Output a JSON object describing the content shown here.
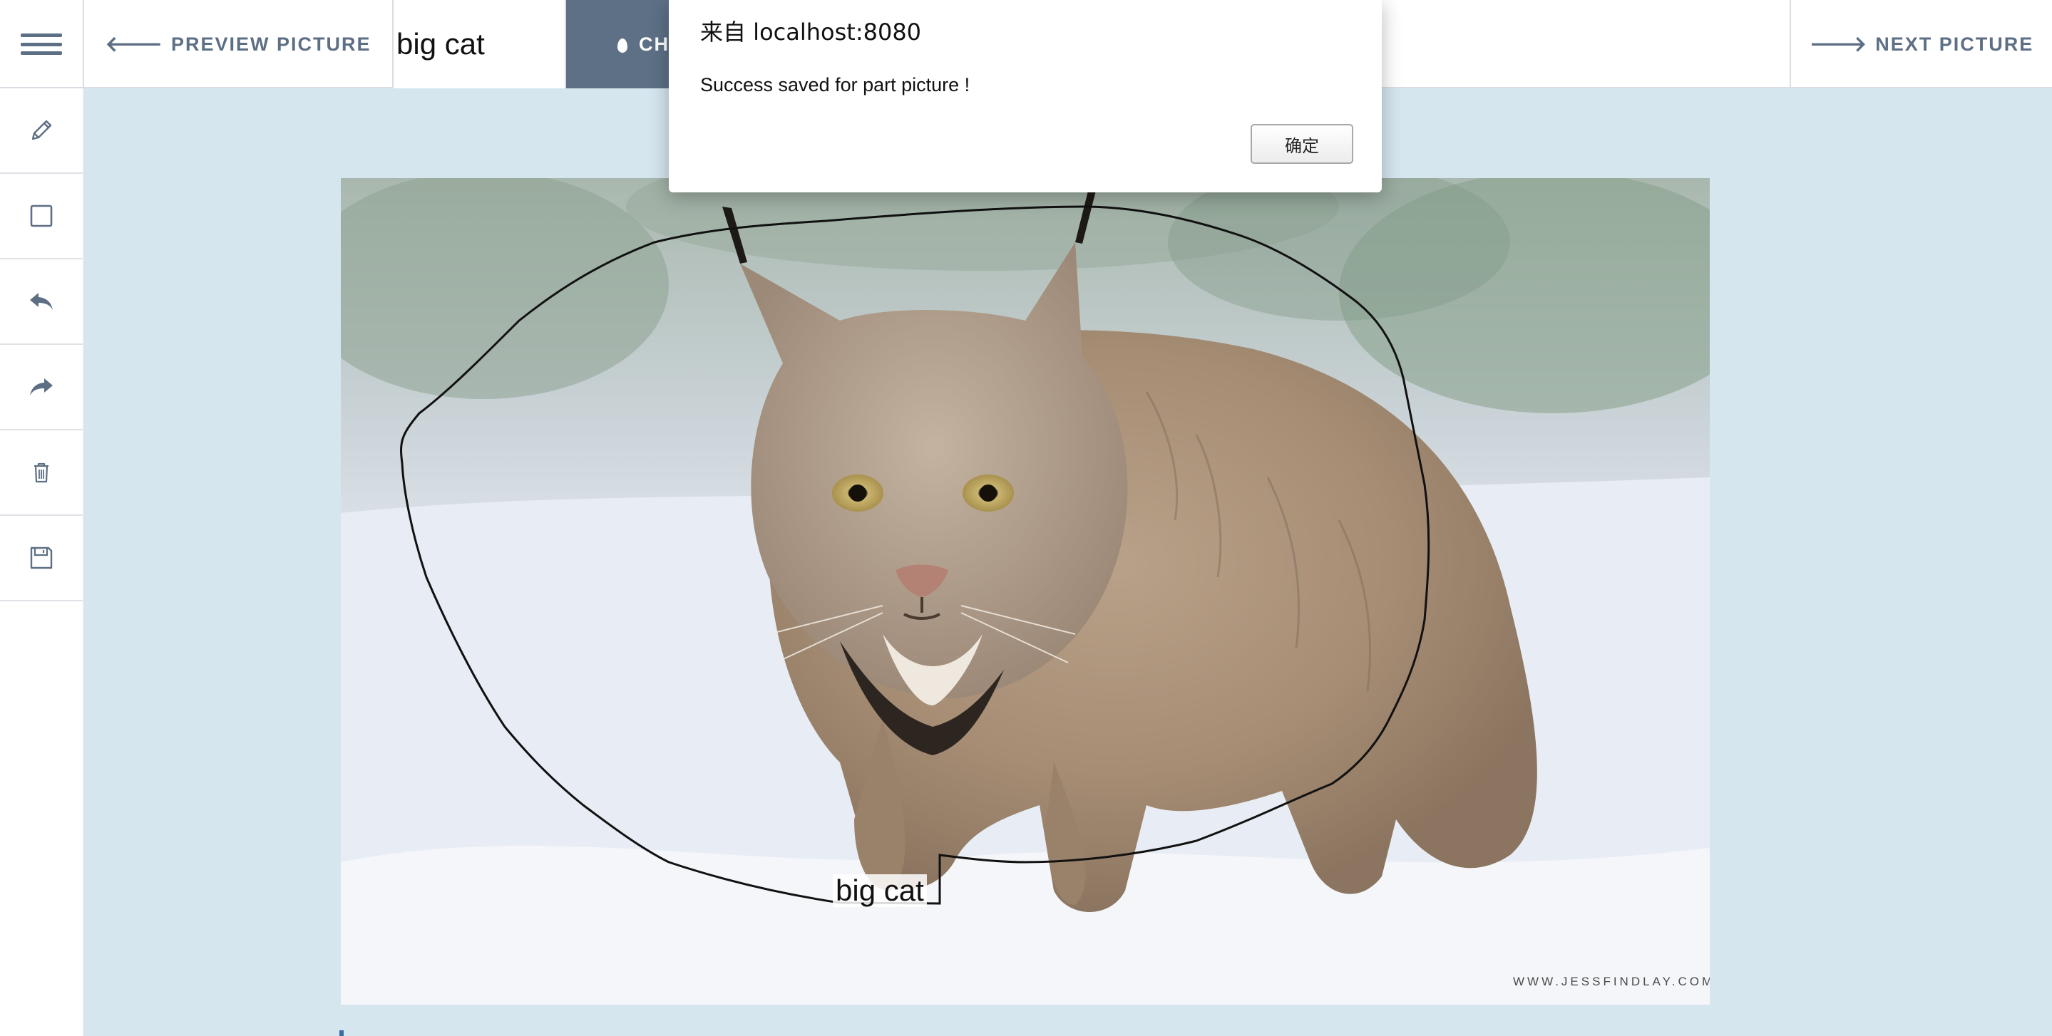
{
  "topbar": {
    "menu_icon": "hamburger-icon",
    "prev_label": "PREVIEW PICTURE",
    "prev_icon": "arrow-left-icon",
    "label_value": "big cat",
    "change_label": "CH",
    "change_icon": "droplet-icon",
    "next_label": "NEXT PICTURE",
    "next_icon": "arrow-right-icon"
  },
  "toolbar": {
    "items": [
      {
        "icon": "pencil-icon"
      },
      {
        "icon": "rectangle-icon"
      },
      {
        "icon": "undo-icon"
      },
      {
        "icon": "redo-icon"
      },
      {
        "icon": "trash-icon"
      },
      {
        "icon": "save-icon"
      }
    ]
  },
  "canvas": {
    "annotation_label": "big cat",
    "watermark": "WWW.JESSFINDLAY.COM"
  },
  "dialog": {
    "title": "来自 localhost:8080",
    "message": "Success saved for part picture !",
    "ok_label": "确定"
  }
}
